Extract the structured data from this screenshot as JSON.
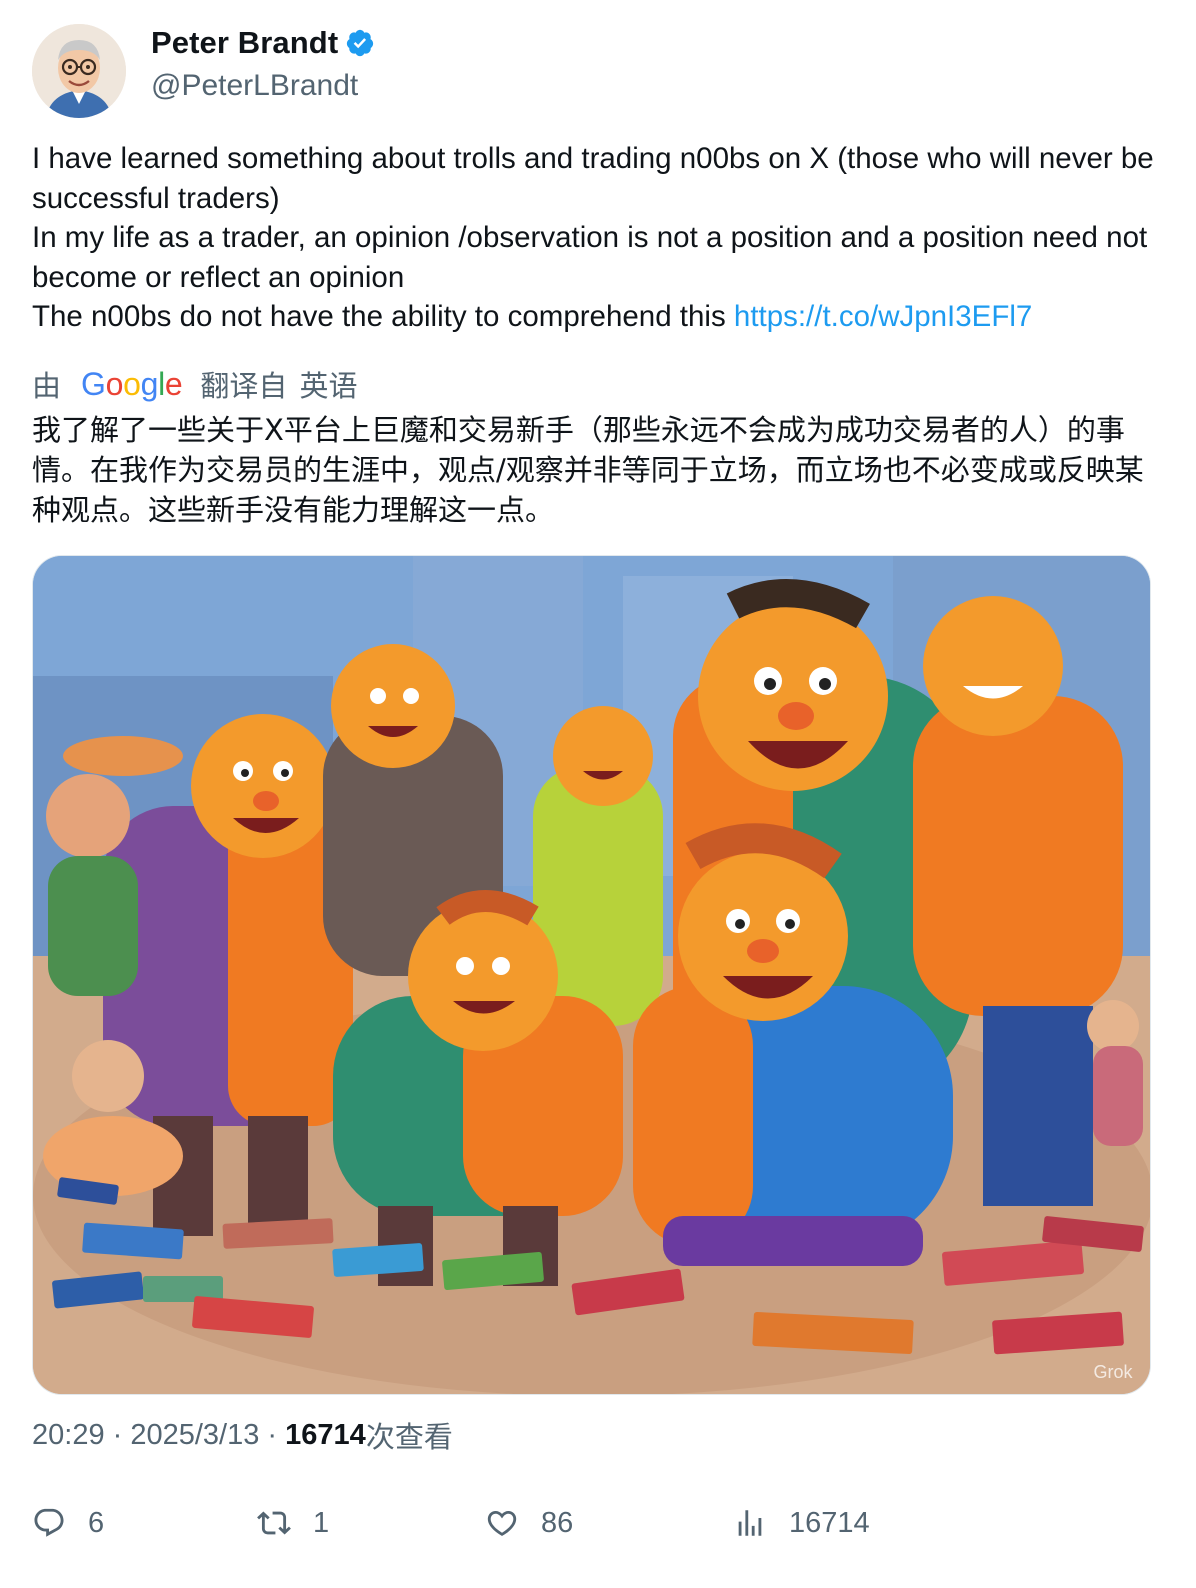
{
  "author": {
    "display_name": "Peter Brandt",
    "handle": "@PeterLBrandt",
    "verified_icon": "verified-badge-icon"
  },
  "tweet": {
    "text": "I have learned something about trolls and trading n00bs on X (those who will never be successful traders)\nIn my life as a trader, an opinion /observation is not a position and a position need not become or reflect an opinion\nThe n00bs do not have the ability to comprehend this ",
    "link": "https://t.co/wJpnI3EFl7"
  },
  "translation": {
    "prefix": "由",
    "provider": "Google",
    "suffix_a": "翻译自",
    "suffix_b": "英语",
    "text": "我了解了一些关于X平台上巨魔和交易新手（那些永远不会成为成功交易者的人）的事情。在我作为交易员的生涯中，观点/观察并非等同于立场，而立场也不必变成或反映某种观点。这些新手没有能力理解这一点。"
  },
  "media": {
    "watermark": "Grok"
  },
  "meta": {
    "time": "20:29",
    "separator": " · ",
    "date": "2025/3/13",
    "views_count": "16714",
    "views_label": "次查看"
  },
  "actions": {
    "replies": "6",
    "reposts": "1",
    "likes": "86",
    "views": "16714"
  },
  "colors": {
    "link": "#1d9bf0",
    "secondary_text": "#536471",
    "verified": "#1d9bf0"
  }
}
